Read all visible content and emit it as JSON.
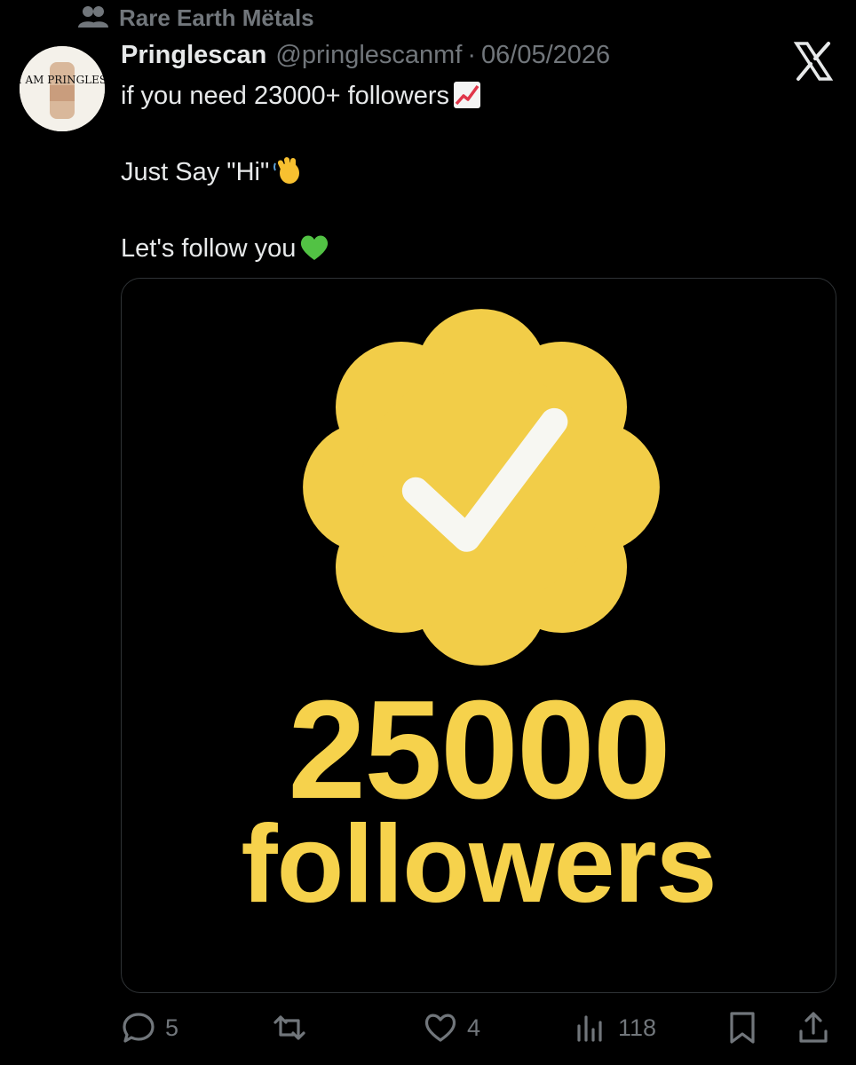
{
  "context": {
    "label": "Rare Earth Mëtals",
    "icon": "community-icon"
  },
  "tweet": {
    "display_name": "Pringlescan",
    "handle": "@pringlescanmf",
    "separator": "·",
    "date": "06/05/2026",
    "lines": [
      "if you need 23000+ followers",
      "Just Say \"Hi\"",
      "Let's follow you"
    ],
    "emojis": [
      "chart-increasing-emoji",
      "waving-hand-emoji",
      "green-heart-emoji"
    ]
  },
  "avatar": {
    "caption": "I AM PRINGLES"
  },
  "media": {
    "number": "25000",
    "label": "followers",
    "badge_color": "#f2cd48",
    "text_color": "#f6d24c"
  },
  "actions": {
    "replies": "5",
    "reposts": "",
    "likes": "4",
    "views": "118"
  },
  "colors": {
    "background": "#000000",
    "text": "#e7e9ea",
    "muted": "#71767b",
    "border": "#2f3336"
  }
}
